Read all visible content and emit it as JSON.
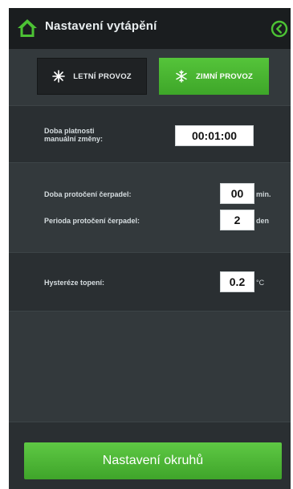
{
  "header": {
    "title": "Nastavení vytápění"
  },
  "modes": {
    "summer_label": "LETNÍ PROVOZ",
    "winter_label": "ZIMNÍ PROVOZ",
    "active": "winter"
  },
  "manual": {
    "label_line1": "Doba platnosti",
    "label_line2": "manuální změny:",
    "value": "00:01:00"
  },
  "pumps": {
    "duration_label": "Doba protočení čerpadel:",
    "duration_value": "00",
    "duration_unit": "min.",
    "period_label": "Perioda protočení čerpadel:",
    "period_value": "2",
    "period_unit": "den"
  },
  "hysteresis": {
    "label": "Hysteréze topení:",
    "value": "0.2",
    "unit": "°C"
  },
  "footer": {
    "circuits_button": "Nastavení okruhů"
  },
  "colors": {
    "accent_green": "#47b52f",
    "header_bg": "#1a1d1f",
    "panel_bg": "#33393c"
  }
}
